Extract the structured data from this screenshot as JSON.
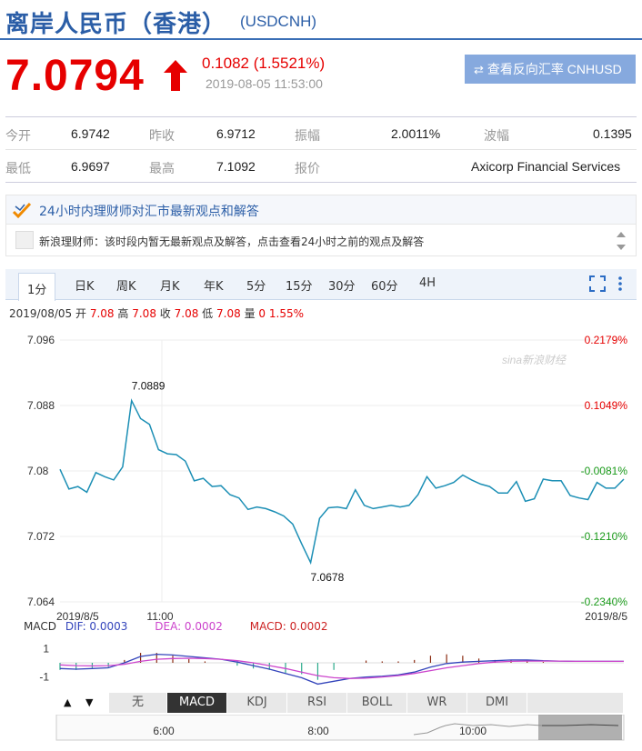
{
  "header": {
    "name": "离岸人民币（香港）",
    "code": "(USDCNH)"
  },
  "quote": {
    "price": "7.0794",
    "change": "0.1082 (1.5521%)",
    "time": "2019-08-05 11:53:00",
    "reverse_button": "查看反向汇率 CNHUSD",
    "up_color": "#e60000"
  },
  "stats": {
    "open_label": "今开",
    "open": "6.9742",
    "prev_close_label": "昨收",
    "prev_close": "6.9712",
    "amplitude_label": "振幅",
    "amplitude": "2.0011%",
    "range_label": "波幅",
    "range": "0.1395",
    "low_label": "最低",
    "low": "6.9697",
    "high_label": "最高",
    "high": "7.1092",
    "quoter_label": "报价",
    "quoter": "Axicorp Financial Services"
  },
  "advice": {
    "title": "24小时内理财师对汇市最新观点和解答",
    "message": "新浪理财师：该时段内暂无最新观点及解答，点击查看24小时之前的观点及解答"
  },
  "chart_tabs": [
    "1分",
    "日K",
    "周K",
    "月K",
    "年K",
    "5分",
    "15分",
    "30分",
    "60分",
    "4H"
  ],
  "ohlc_line": {
    "date": "2019/08/05",
    "open_label": "开",
    "open": "7.08",
    "high_label": "高",
    "high": "7.08",
    "close_label": "收",
    "close": "7.08",
    "low_label": "低",
    "low": "7.08",
    "vol_label": "量",
    "vol": "0",
    "pct": "1.55%"
  },
  "watermark": "sina新浪财经",
  "chart_data": {
    "type": "line",
    "title": "",
    "ylim": [
      7.064,
      7.096
    ],
    "y_ticks": [
      "7.096",
      "7.088",
      "7.08",
      "7.072",
      "7.064"
    ],
    "pct_ticks": [
      "0.2179%",
      "0.1049%",
      "-0.0081%",
      "-0.1210%",
      "-0.2340%"
    ],
    "pct_colors": [
      "#e60000",
      "#e60000",
      "#1a9a1a",
      "#1a9a1a",
      "#1a9a1a"
    ],
    "x_labels": [
      "2019/8/5",
      "11:00",
      "2019/8/5"
    ],
    "annotations": [
      {
        "label": "7.0889"
      },
      {
        "label": "7.0678"
      }
    ],
    "series": [
      {
        "values": [
          7.0802,
          7.0778,
          7.0781,
          7.0774,
          7.0798,
          7.0793,
          7.0789,
          7.0805,
          7.0886,
          7.0864,
          7.0857,
          7.0826,
          7.0821,
          7.082,
          7.0812,
          7.0788,
          7.0791,
          7.0781,
          7.0782,
          7.0771,
          7.0767,
          7.0753,
          7.0756,
          7.0754,
          7.075,
          7.0745,
          7.0735,
          7.0711,
          7.0688,
          7.0742,
          7.0755,
          7.0756,
          7.0754,
          7.0777,
          7.0758,
          7.0754,
          7.0756,
          7.0758,
          7.0756,
          7.0758,
          7.0771,
          7.0793,
          7.0779,
          7.0782,
          7.0786,
          7.0795,
          7.0789,
          7.0784,
          7.0781,
          7.0773,
          7.0773,
          7.0787,
          7.0763,
          7.0766,
          7.079,
          7.0788,
          7.0788,
          7.077,
          7.0767,
          7.0765,
          7.0786,
          7.0779,
          7.0779,
          7.079
        ],
        "color": "#1c8fb5"
      }
    ],
    "macd": {
      "dif_label": "DIF: 0.0003",
      "dea_label": "DEA: 0.0002",
      "macd_label": "MACD: 0.0002",
      "name": "MACD",
      "y_ticks": [
        "1",
        "-1"
      ],
      "dif": [
        -0.4,
        -0.45,
        -0.4,
        -0.35,
        0.0,
        0.45,
        0.6,
        0.55,
        0.45,
        0.35,
        0.25,
        0.05,
        -0.2,
        -0.45,
        -0.75,
        -1.05,
        -1.5,
        -1.3,
        -1.1,
        -1.0,
        -0.95,
        -0.85,
        -0.65,
        -0.3,
        -0.05,
        0.05,
        0.1,
        0.15,
        0.2,
        0.2,
        0.15,
        0.12,
        0.1,
        0.1,
        0.1,
        0.1
      ],
      "dea": [
        -0.15,
        -0.2,
        -0.22,
        -0.2,
        -0.1,
        0.1,
        0.25,
        0.3,
        0.32,
        0.3,
        0.25,
        0.15,
        0.0,
        -0.2,
        -0.4,
        -0.65,
        -0.9,
        -1.05,
        -1.1,
        -1.08,
        -1.0,
        -0.9,
        -0.75,
        -0.55,
        -0.35,
        -0.2,
        -0.05,
        0.05,
        0.1,
        0.12,
        0.12,
        0.12,
        0.1,
        0.1,
        0.1,
        0.1
      ],
      "dif_color": "#3344bb",
      "dea_color": "#cc44cc",
      "macd_color": "#cc2222",
      "up_bar_color": "#8b2a10",
      "down_bar_color": "#2aaa8a"
    },
    "navigator_labels": [
      "6:00",
      "8:00",
      "10:00"
    ]
  },
  "indicator_tabs": [
    "无",
    "MACD",
    "KDJ",
    "RSI",
    "BOLL",
    "WR",
    "DMI"
  ],
  "active_indicator": "MACD"
}
